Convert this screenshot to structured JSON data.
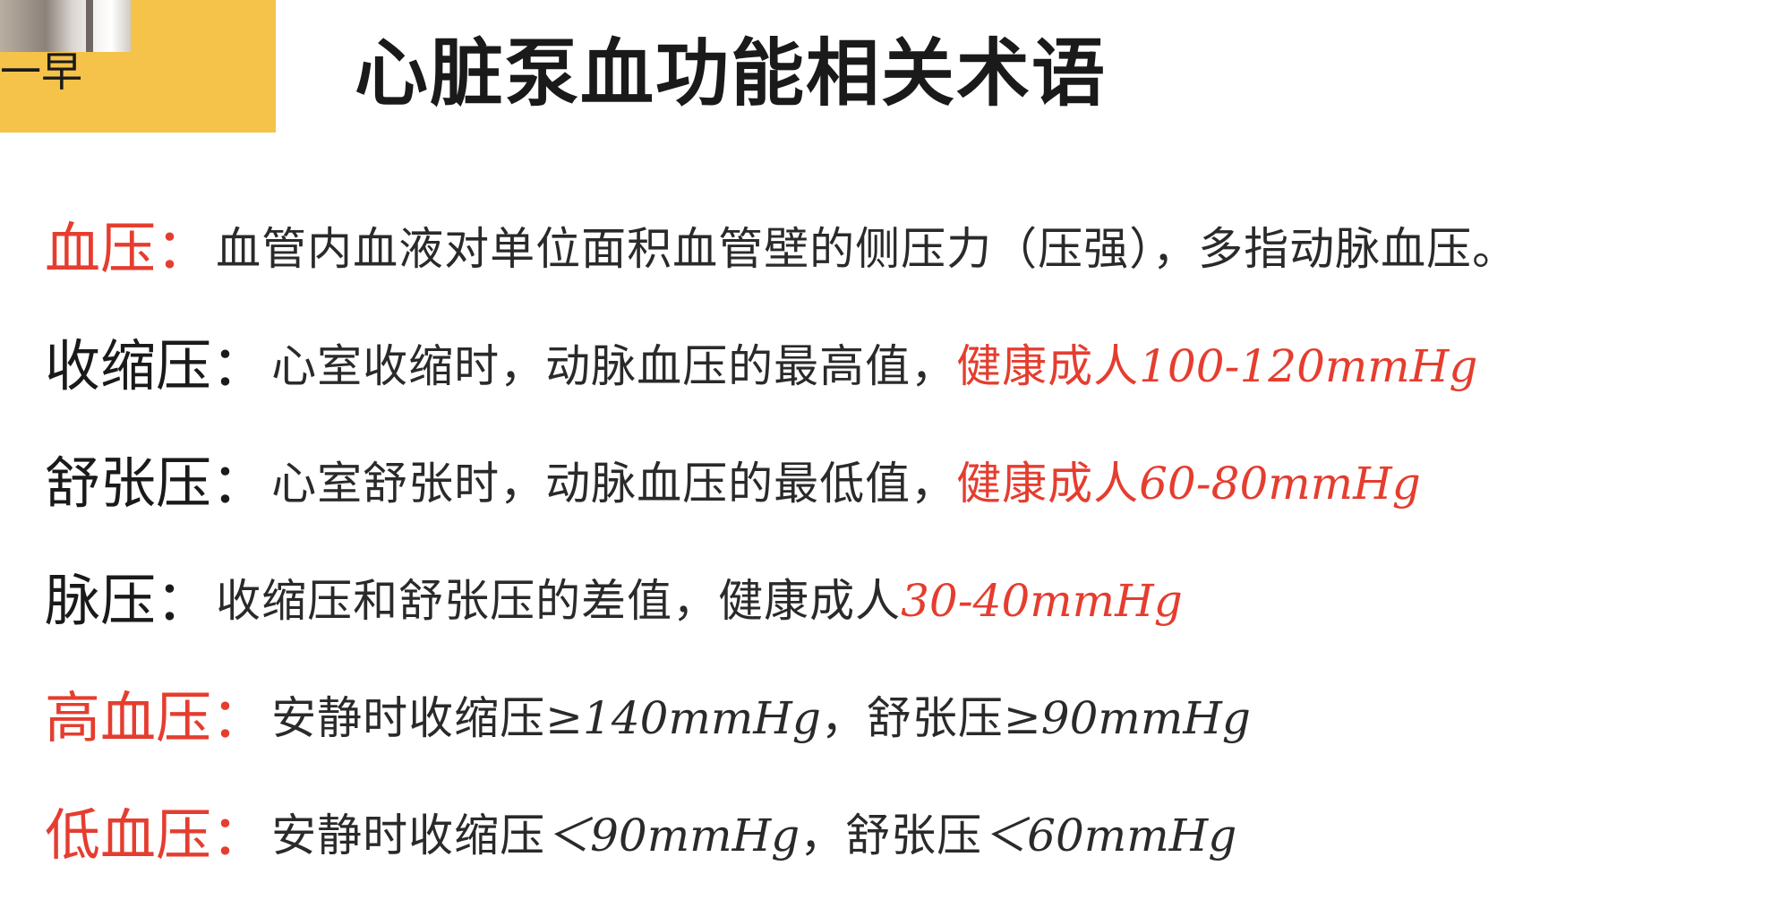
{
  "header": {
    "corner_text": "一早",
    "title": "心脏泵血功能相关术语"
  },
  "colors": {
    "accent_red": "#e53d2f",
    "tab_yellow": "#f5c24a",
    "text_dark": "#1a1a1a"
  },
  "terms": [
    {
      "label": "血压",
      "colon": "：",
      "description": "血管内血液对单位面积血管壁的侧压力（压强），多指动脉血压。",
      "value_prefix": "",
      "value": ""
    },
    {
      "label": "收缩压",
      "colon": "：",
      "description": "心室收缩时，动脉血压的最高值，",
      "value_prefix": "健康成人",
      "value": "100-120mmHg"
    },
    {
      "label": "舒张压",
      "colon": "：",
      "description": "心室舒张时，动脉血压的最低值，",
      "value_prefix": "健康成人",
      "value": "60-80mmHg"
    },
    {
      "label": "脉压",
      "colon": "：",
      "description": "收缩压和舒张压的差值，健康成人",
      "value_prefix": "",
      "value": "30-40mmHg"
    },
    {
      "label": "高血压",
      "colon": "：",
      "description_a": "安静时收缩压",
      "value_a": "≥140mmHg",
      "sep": "，",
      "description_b": "舒张压",
      "value_b": "≥90mmHg"
    },
    {
      "label": "低血压",
      "colon": "：",
      "description_a": "安静时收缩压",
      "value_a": "＜90mmHg",
      "sep": "，",
      "description_b": "舒张压",
      "value_b": "＜60mmHg"
    }
  ]
}
